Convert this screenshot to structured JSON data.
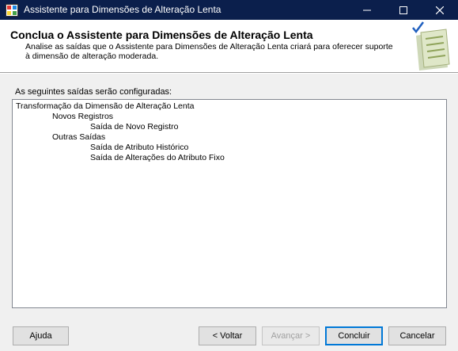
{
  "window": {
    "title": "Assistente para Dimensões de Alteração Lenta"
  },
  "header": {
    "title": "Conclua o Assistente para Dimensões de Alteração Lenta",
    "description": "Analise as saídas que o Assistente para Dimensões de Alteração Lenta criará para oferecer suporte à dimensão de alteração moderada."
  },
  "main": {
    "intro": "As seguintes saídas serão configuradas:",
    "tree": {
      "root": "Transformação da Dimensão de Alteração Lenta",
      "group1": "Novos Registros",
      "group1_item1": "Saída de Novo Registro",
      "group2": "Outras Saídas",
      "group2_item1": "Saída de Atributo Histórico",
      "group2_item2": "Saída de Alterações do Atributo Fixo"
    }
  },
  "buttons": {
    "help": "Ajuda",
    "back": "< Voltar",
    "next": "Avançar >",
    "finish": "Concluir",
    "cancel": "Cancelar"
  }
}
